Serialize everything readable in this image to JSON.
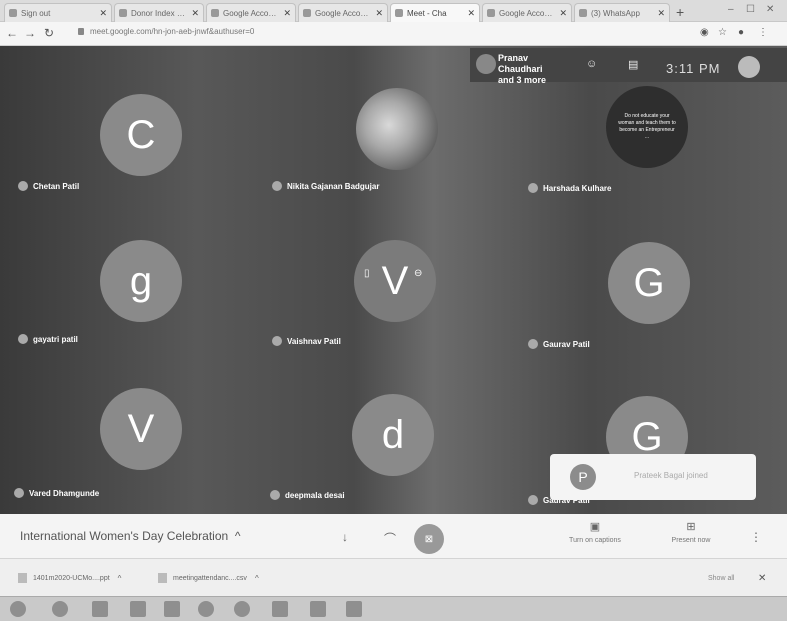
{
  "browser": {
    "tabs": [
      {
        "title": "Sign out",
        "active": false
      },
      {
        "title": "Donor Index (Pe)",
        "active": false
      },
      {
        "title": "Google Account",
        "active": false
      },
      {
        "title": "Google Account",
        "active": false
      },
      {
        "title": "Meet - Cha",
        "active": true
      },
      {
        "title": "Google Account",
        "active": false
      },
      {
        "title": "(3) WhatsApp",
        "active": false
      }
    ],
    "new_tab_symbol": "+",
    "url": "meet.google.com/hn-jon-aeb-jnwf&authuser=0",
    "window_controls": {
      "minimize": "–",
      "maximize": "☐",
      "close": "✕"
    }
  },
  "meet": {
    "header": {
      "host_line1": "Pranav Chaudhari",
      "host_line2": "and 3 more",
      "time": "3:11 PM"
    },
    "participants": [
      {
        "initial": "C",
        "name": "Chetan Patil",
        "style": "letter"
      },
      {
        "initial": "",
        "name": "Nikita Gajanan Badgujar",
        "style": "photo"
      },
      {
        "initial": "Do not educate your woman and teach them to become an Entrepreneur ...",
        "name": "Harshada Kulhare",
        "style": "quote"
      },
      {
        "initial": "g",
        "name": "gayatri patil",
        "style": "letter"
      },
      {
        "initial": "V",
        "name": "Vaishnav Patil",
        "style": "speaking"
      },
      {
        "initial": "G",
        "name": "Gaurav Patil",
        "style": "letter"
      },
      {
        "initial": "V",
        "name": "Vared Dhamgunde",
        "style": "letter"
      },
      {
        "initial": "d",
        "name": "deepmala desai",
        "style": "letter"
      },
      {
        "initial": "G",
        "name": "Gaurav Patil",
        "style": "letter"
      }
    ],
    "toast": {
      "initial": "P",
      "text": "Prateek Bagal joined"
    }
  },
  "bottom_bar": {
    "meeting_title": "International Women's Day Celebration",
    "caption_label": "Turn on captions",
    "present_label": "Present now"
  },
  "downloads": {
    "items": [
      {
        "name": "1401m2020-UCMo....ppt"
      },
      {
        "name": "meetingattendanc....csv"
      }
    ],
    "show_all": "Show all",
    "close": "✕"
  }
}
